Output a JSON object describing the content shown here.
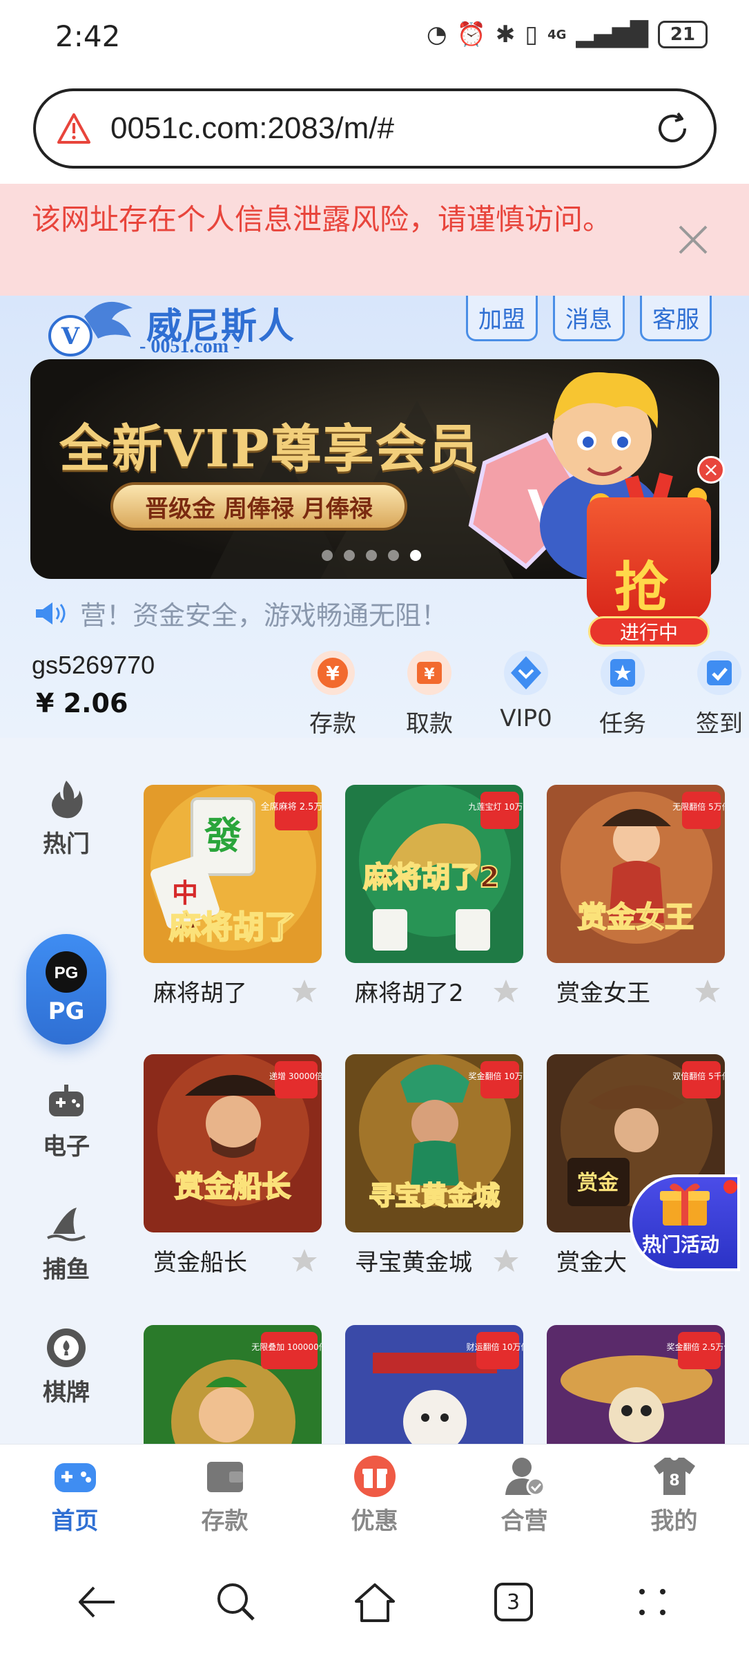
{
  "status_bar": {
    "time": "2:42",
    "network": "4G",
    "battery": "21"
  },
  "browser": {
    "url": "0051c.com:2083/m/#"
  },
  "warning": {
    "message": "该网址存在个人信息泄露风险，请谨慎访问。"
  },
  "header": {
    "logo_text": "威尼斯人",
    "logo_sub": "- 0051.com -",
    "buttons": [
      "加盟",
      "消息",
      "客服"
    ]
  },
  "banner": {
    "title": "全新VIP尊享会员",
    "pill": "晋级金 周俸禄 月俸禄",
    "slides": 5,
    "active_slide": 5
  },
  "notice": {
    "text": "营！资金安全，游戏畅通无阻！"
  },
  "user": {
    "name": "gs5269770",
    "balance": "¥ 2.06"
  },
  "actions": [
    {
      "label": "存款",
      "icon": "deposit-icon",
      "color": "#f26a2e"
    },
    {
      "label": "取款",
      "icon": "withdraw-icon",
      "color": "#f26a2e"
    },
    {
      "label": "VIP0",
      "icon": "vip-icon",
      "color": "#3f8df2"
    },
    {
      "label": "任务",
      "icon": "task-icon",
      "color": "#3f8df2"
    },
    {
      "label": "签到",
      "icon": "checkin-icon",
      "color": "#3f8df2"
    }
  ],
  "redpack": {
    "char": "抢",
    "tag": "进行中"
  },
  "categories": [
    {
      "label": "热门",
      "icon": "flame-icon"
    },
    {
      "label": "PG",
      "icon": "pg-logo-icon",
      "active": true
    },
    {
      "label": "电子",
      "icon": "gamepad-icon"
    },
    {
      "label": "捕鱼",
      "icon": "shark-fin-icon"
    },
    {
      "label": "棋牌",
      "icon": "chip-icon"
    }
  ],
  "games": [
    {
      "title": "麻将胡了",
      "badge": "全席麻将 2.5万倍"
    },
    {
      "title": "麻将胡了2",
      "badge": "九莲宝灯 10万倍"
    },
    {
      "title": "赏金女王",
      "badge": "无限翻倍 5万倍"
    },
    {
      "title": "赏金船长",
      "badge": "递增 30000倍"
    },
    {
      "title": "寻宝黄金城",
      "badge": "奖金翻倍 10万倍"
    },
    {
      "title": "赏金大",
      "badge": "双倍翻倍 5千倍"
    },
    {
      "title": "",
      "badge": "无限叠加 100000倍"
    },
    {
      "title": "",
      "badge": "财运翻倍 10万倍"
    },
    {
      "title": "",
      "badge": "奖金翻倍 2.5万倍"
    }
  ],
  "hot_activity": {
    "label": "热门活动"
  },
  "tabbar": [
    {
      "label": "首页",
      "icon": "gamepad-icon",
      "active": true
    },
    {
      "label": "存款",
      "icon": "wallet-icon"
    },
    {
      "label": "优惠",
      "icon": "gift-icon"
    },
    {
      "label": "合营",
      "icon": "partner-icon"
    },
    {
      "label": "我的",
      "icon": "shirt-icon"
    }
  ],
  "sysnav": {
    "tabs_count": "3"
  },
  "colors": {
    "accent": "#2f6fd3",
    "warning": "#e8453c",
    "orange": "#f26a2e"
  }
}
